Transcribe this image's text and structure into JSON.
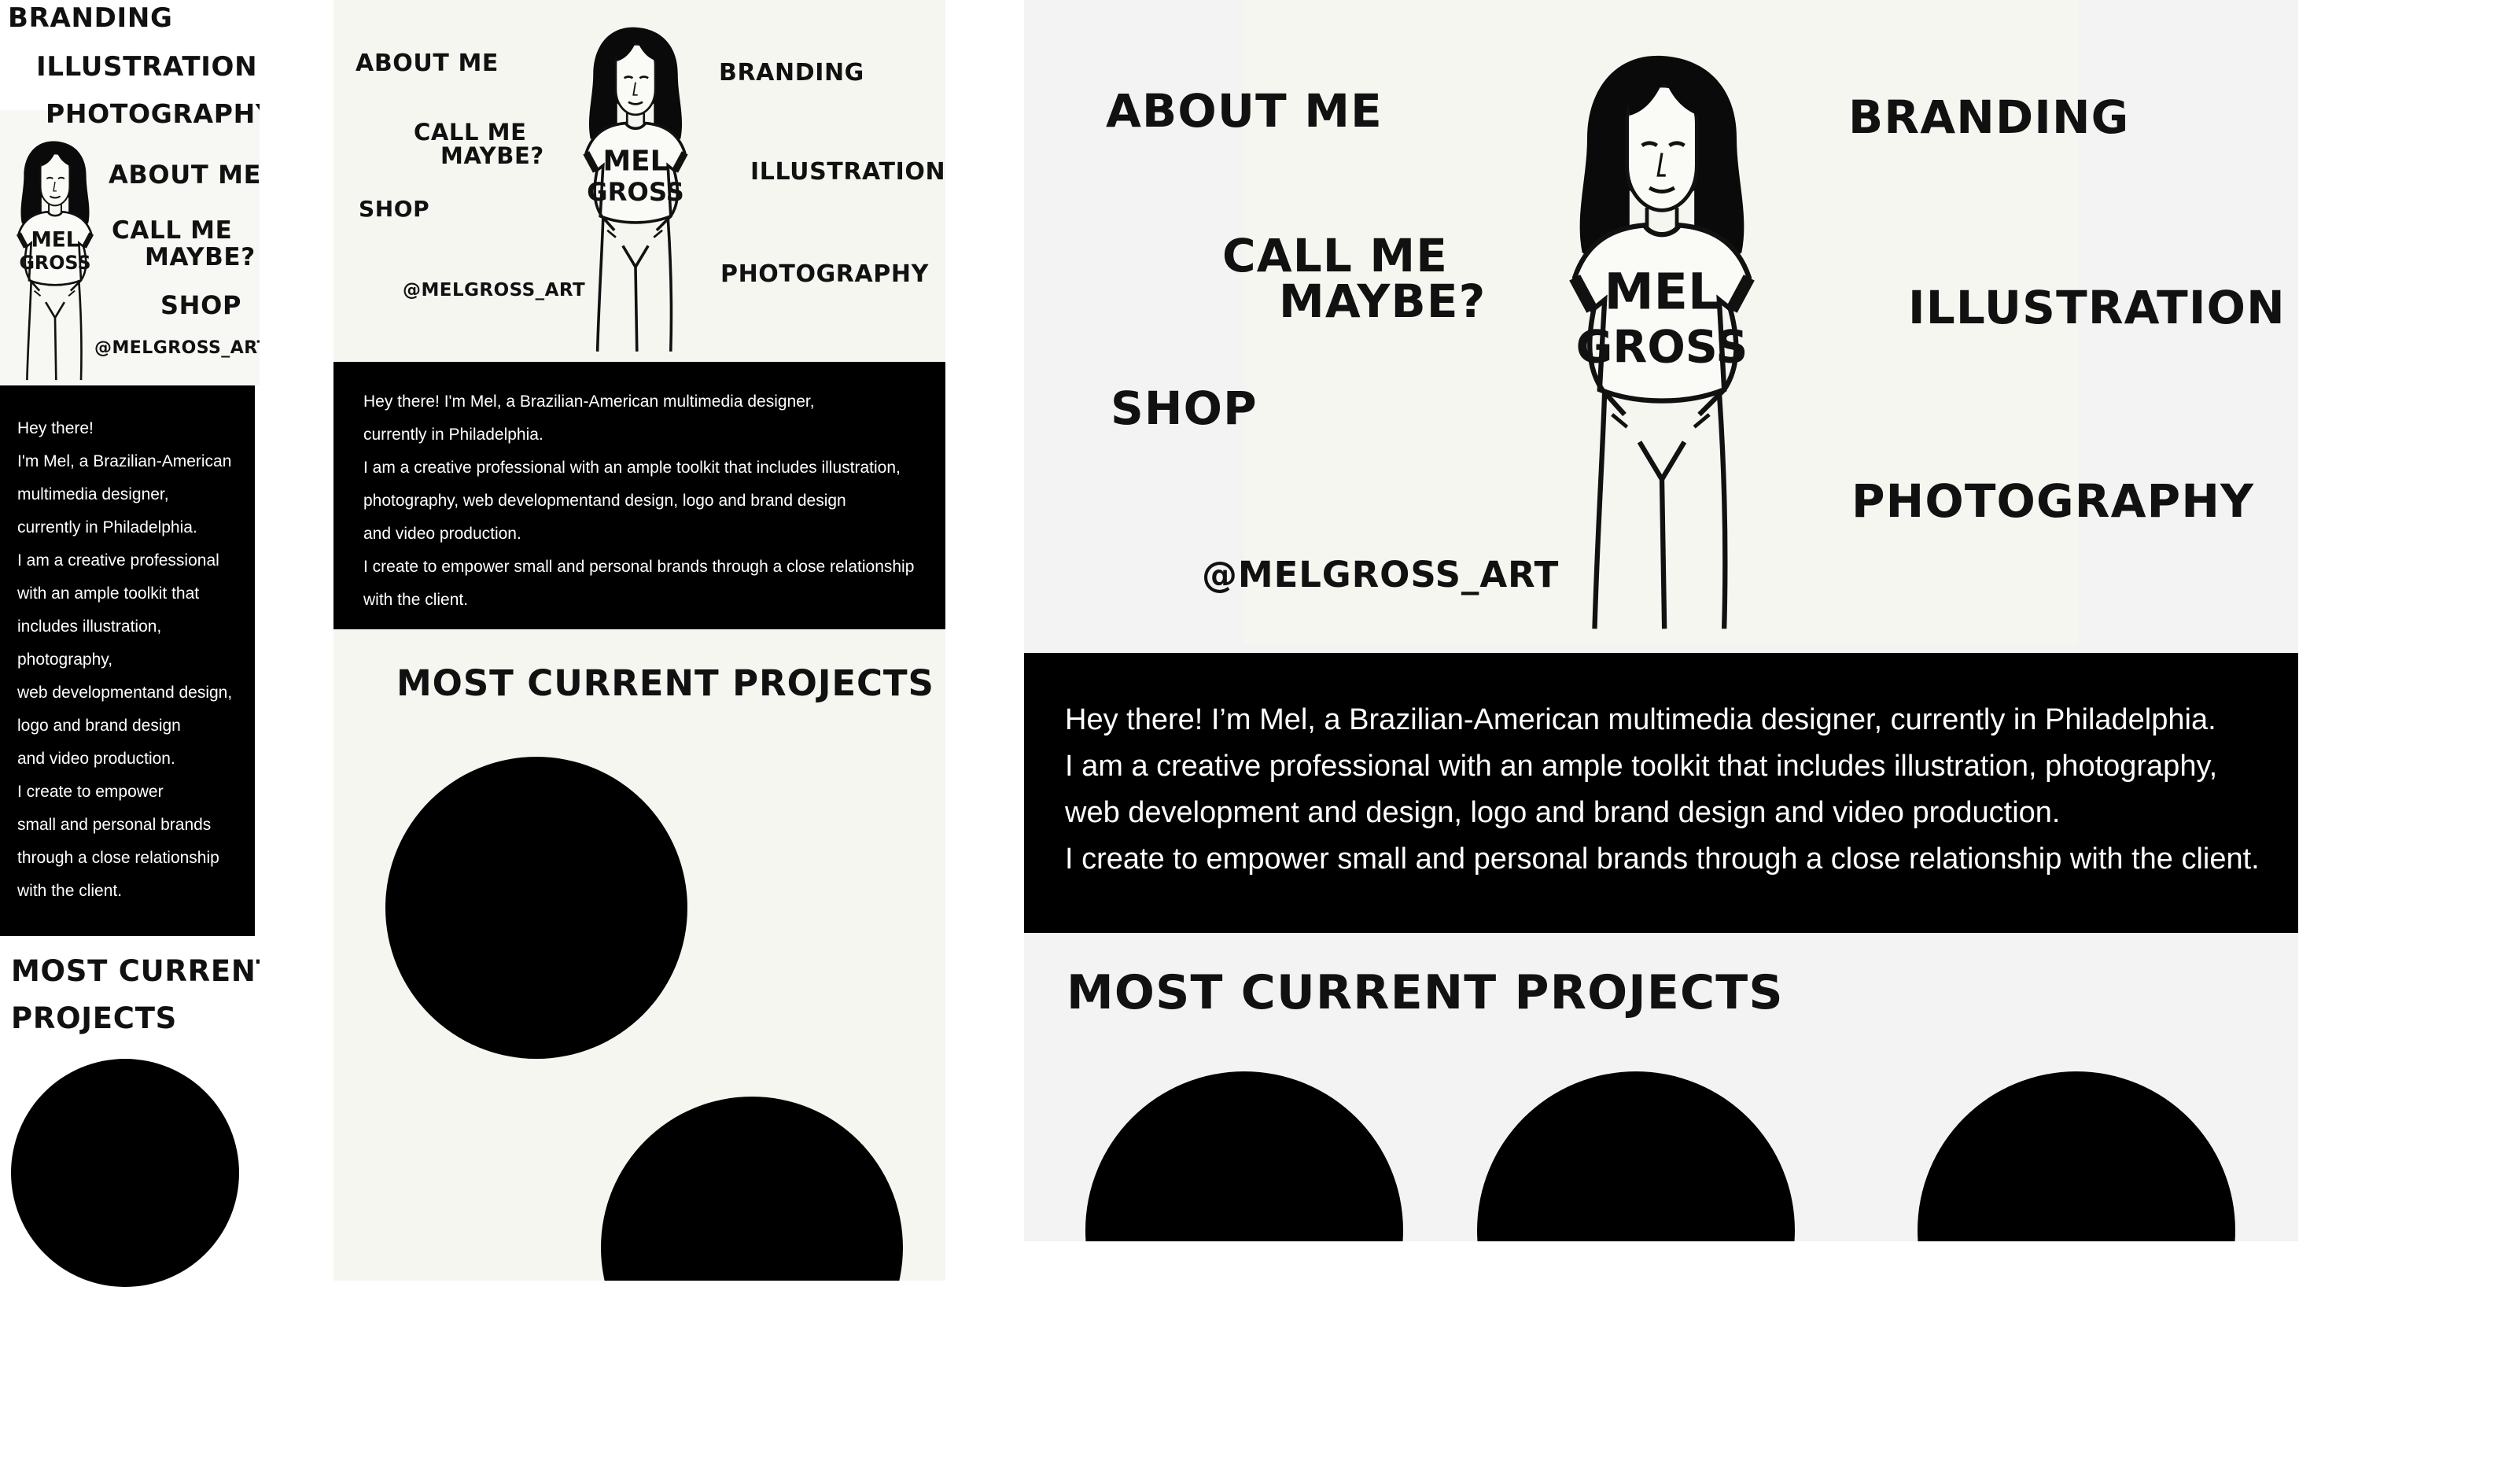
{
  "nav": {
    "about": "ABOUT ME",
    "branding": "BRANDING",
    "illustration": "ILLUSTRATION",
    "photography": "PHOTOGRAPHY",
    "call1": "CALL ME",
    "call2": "MAYBE?",
    "shop": "SHOP",
    "handle": "@MELGROSS_ART"
  },
  "shirt": {
    "line1": "MEL",
    "line2": "GROSS"
  },
  "bio": {
    "mobile": [
      "Hey there!",
      "I'm Mel, a Brazilian-American",
      "multimedia designer,",
      "currently in Philadelphia.",
      "I am a creative professional",
      " with an ample toolkit that",
      "includes illustration,",
      "photography,",
      " web developmentand design,",
      " logo and brand design",
      "and video production.",
      "I create to empower",
      "small and personal brands",
      "through a close relationship",
      " with the client."
    ],
    "tablet": [
      "Hey there! I'm Mel, a Brazilian-American multimedia designer,",
      "currently in Philadelphia.",
      "I am a creative professional  with an ample toolkit that includes illustration,",
      "photography,  web developmentand design,  logo and brand design",
      "and video production.",
      "I create to empower  small and personal brands  through a close relationship",
      " with the client."
    ],
    "desktop": [
      "Hey there! I’m Mel, a Brazilian-American multimedia designer, currently in Philadelphia.",
      "I am a creative professional with an ample toolkit that includes illustration, photography,",
      "web development and design, logo and brand design and video production.",
      "I create to empower small and personal brands through a close relationship with the client."
    ]
  },
  "projects": {
    "heading": "MOST CURRENT PROJECTS",
    "heading_mobile_1": "MOST CURRENT",
    "heading_mobile_2": "PROJECTS"
  },
  "colors": {
    "ink": "#000000",
    "paper_tablet": "#f6f6f1",
    "paper_desktop": "#f3f3f3",
    "paper_mobile": "#f7f7f4",
    "text_on_dark": "#ffffff"
  }
}
